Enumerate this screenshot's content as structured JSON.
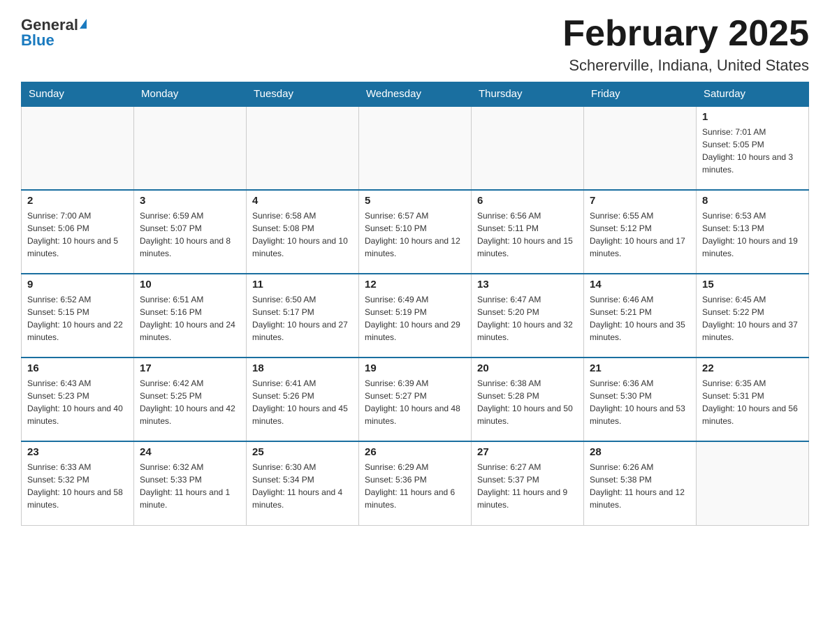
{
  "logo": {
    "general": "General",
    "blue": "Blue"
  },
  "header": {
    "title": "February 2025",
    "location": "Schererville, Indiana, United States"
  },
  "weekdays": [
    "Sunday",
    "Monday",
    "Tuesday",
    "Wednesday",
    "Thursday",
    "Friday",
    "Saturday"
  ],
  "weeks": [
    [
      {
        "day": "",
        "info": ""
      },
      {
        "day": "",
        "info": ""
      },
      {
        "day": "",
        "info": ""
      },
      {
        "day": "",
        "info": ""
      },
      {
        "day": "",
        "info": ""
      },
      {
        "day": "",
        "info": ""
      },
      {
        "day": "1",
        "info": "Sunrise: 7:01 AM\nSunset: 5:05 PM\nDaylight: 10 hours and 3 minutes."
      }
    ],
    [
      {
        "day": "2",
        "info": "Sunrise: 7:00 AM\nSunset: 5:06 PM\nDaylight: 10 hours and 5 minutes."
      },
      {
        "day": "3",
        "info": "Sunrise: 6:59 AM\nSunset: 5:07 PM\nDaylight: 10 hours and 8 minutes."
      },
      {
        "day": "4",
        "info": "Sunrise: 6:58 AM\nSunset: 5:08 PM\nDaylight: 10 hours and 10 minutes."
      },
      {
        "day": "5",
        "info": "Sunrise: 6:57 AM\nSunset: 5:10 PM\nDaylight: 10 hours and 12 minutes."
      },
      {
        "day": "6",
        "info": "Sunrise: 6:56 AM\nSunset: 5:11 PM\nDaylight: 10 hours and 15 minutes."
      },
      {
        "day": "7",
        "info": "Sunrise: 6:55 AM\nSunset: 5:12 PM\nDaylight: 10 hours and 17 minutes."
      },
      {
        "day": "8",
        "info": "Sunrise: 6:53 AM\nSunset: 5:13 PM\nDaylight: 10 hours and 19 minutes."
      }
    ],
    [
      {
        "day": "9",
        "info": "Sunrise: 6:52 AM\nSunset: 5:15 PM\nDaylight: 10 hours and 22 minutes."
      },
      {
        "day": "10",
        "info": "Sunrise: 6:51 AM\nSunset: 5:16 PM\nDaylight: 10 hours and 24 minutes."
      },
      {
        "day": "11",
        "info": "Sunrise: 6:50 AM\nSunset: 5:17 PM\nDaylight: 10 hours and 27 minutes."
      },
      {
        "day": "12",
        "info": "Sunrise: 6:49 AM\nSunset: 5:19 PM\nDaylight: 10 hours and 29 minutes."
      },
      {
        "day": "13",
        "info": "Sunrise: 6:47 AM\nSunset: 5:20 PM\nDaylight: 10 hours and 32 minutes."
      },
      {
        "day": "14",
        "info": "Sunrise: 6:46 AM\nSunset: 5:21 PM\nDaylight: 10 hours and 35 minutes."
      },
      {
        "day": "15",
        "info": "Sunrise: 6:45 AM\nSunset: 5:22 PM\nDaylight: 10 hours and 37 minutes."
      }
    ],
    [
      {
        "day": "16",
        "info": "Sunrise: 6:43 AM\nSunset: 5:23 PM\nDaylight: 10 hours and 40 minutes."
      },
      {
        "day": "17",
        "info": "Sunrise: 6:42 AM\nSunset: 5:25 PM\nDaylight: 10 hours and 42 minutes."
      },
      {
        "day": "18",
        "info": "Sunrise: 6:41 AM\nSunset: 5:26 PM\nDaylight: 10 hours and 45 minutes."
      },
      {
        "day": "19",
        "info": "Sunrise: 6:39 AM\nSunset: 5:27 PM\nDaylight: 10 hours and 48 minutes."
      },
      {
        "day": "20",
        "info": "Sunrise: 6:38 AM\nSunset: 5:28 PM\nDaylight: 10 hours and 50 minutes."
      },
      {
        "day": "21",
        "info": "Sunrise: 6:36 AM\nSunset: 5:30 PM\nDaylight: 10 hours and 53 minutes."
      },
      {
        "day": "22",
        "info": "Sunrise: 6:35 AM\nSunset: 5:31 PM\nDaylight: 10 hours and 56 minutes."
      }
    ],
    [
      {
        "day": "23",
        "info": "Sunrise: 6:33 AM\nSunset: 5:32 PM\nDaylight: 10 hours and 58 minutes."
      },
      {
        "day": "24",
        "info": "Sunrise: 6:32 AM\nSunset: 5:33 PM\nDaylight: 11 hours and 1 minute."
      },
      {
        "day": "25",
        "info": "Sunrise: 6:30 AM\nSunset: 5:34 PM\nDaylight: 11 hours and 4 minutes."
      },
      {
        "day": "26",
        "info": "Sunrise: 6:29 AM\nSunset: 5:36 PM\nDaylight: 11 hours and 6 minutes."
      },
      {
        "day": "27",
        "info": "Sunrise: 6:27 AM\nSunset: 5:37 PM\nDaylight: 11 hours and 9 minutes."
      },
      {
        "day": "28",
        "info": "Sunrise: 6:26 AM\nSunset: 5:38 PM\nDaylight: 11 hours and 12 minutes."
      },
      {
        "day": "",
        "info": ""
      }
    ]
  ]
}
